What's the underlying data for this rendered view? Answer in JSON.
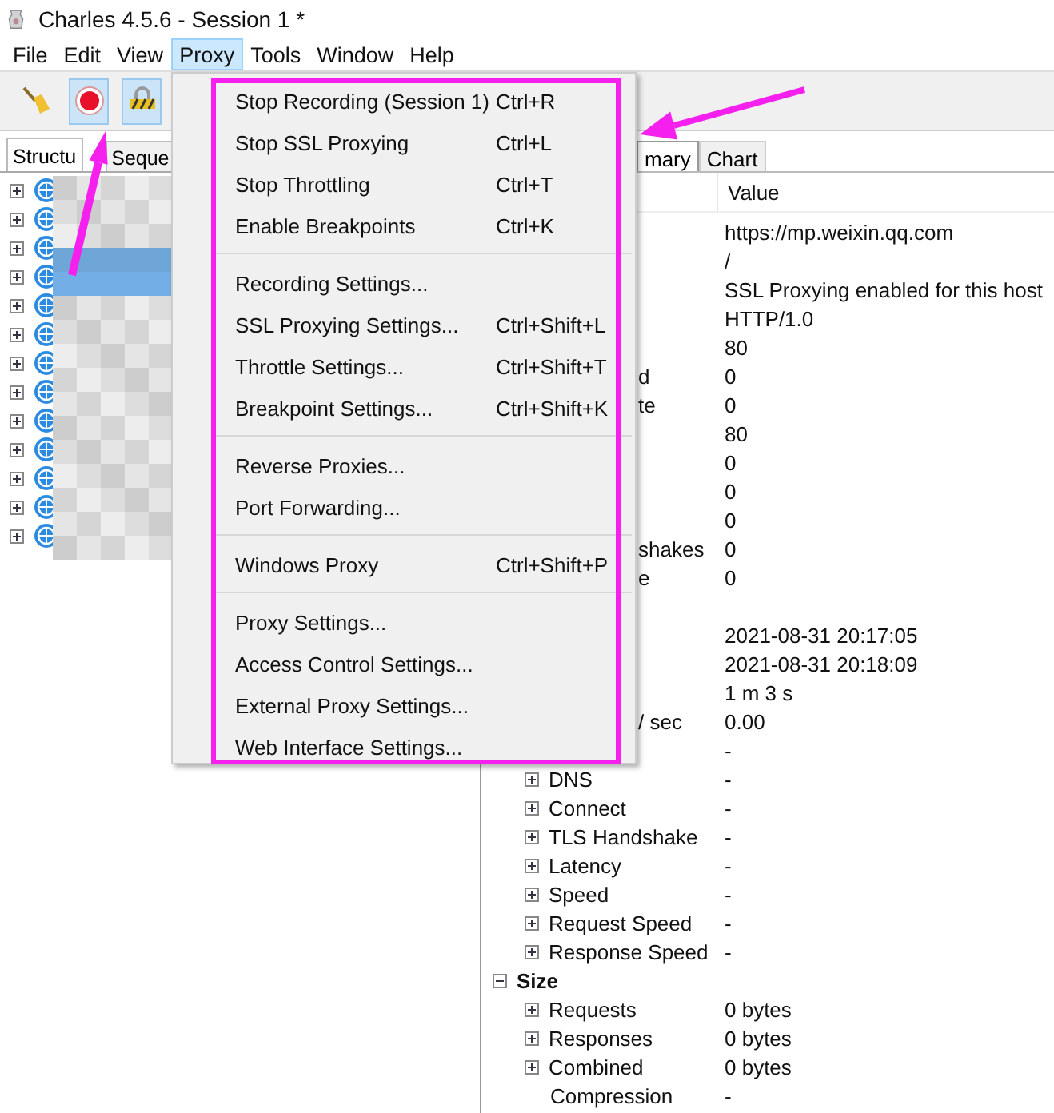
{
  "window": {
    "title": "Charles 4.5.6 - Session 1 *"
  },
  "menu_bar": [
    {
      "label": "File",
      "selected": false
    },
    {
      "label": "Edit",
      "selected": false
    },
    {
      "label": "View",
      "selected": false
    },
    {
      "label": "Proxy",
      "selected": true
    },
    {
      "label": "Tools",
      "selected": false
    },
    {
      "label": "Window",
      "selected": false
    },
    {
      "label": "Help",
      "selected": false
    }
  ],
  "toolbar": [
    {
      "kind": "broom",
      "selected": false
    },
    {
      "kind": "record",
      "selected": true
    },
    {
      "kind": "lock",
      "selected": true
    }
  ],
  "left_panel": {
    "tabs": [
      {
        "label": "Structu",
        "selected": true
      },
      {
        "label": "Seque",
        "selected": false
      }
    ],
    "nodes": [
      {
        "expanded": false
      },
      {
        "expanded": false
      },
      {
        "expanded": false
      },
      {
        "expanded": false
      },
      {
        "expanded": false
      },
      {
        "expanded": false
      },
      {
        "expanded": false
      },
      {
        "expanded": false
      },
      {
        "expanded": false
      },
      {
        "expanded": false
      },
      {
        "expanded": false
      },
      {
        "expanded": false
      },
      {
        "expanded": false
      }
    ]
  },
  "right_panel": {
    "tabs": [
      {
        "label": "mary",
        "selected": true
      },
      {
        "label": "Chart",
        "selected": false
      }
    ],
    "columns": [
      "Value"
    ],
    "rows": [
      {
        "kind": "clipped",
        "value": "https://mp.weixin.qq.com"
      },
      {
        "kind": "clipped",
        "value": "/"
      },
      {
        "kind": "clipped",
        "value": "SSL Proxying enabled for this host"
      },
      {
        "kind": "clipped",
        "value": "HTTP/1.0"
      },
      {
        "kind": "clipped",
        "value": "80"
      },
      {
        "kind": "clipped",
        "name": "d",
        "value": "0"
      },
      {
        "kind": "clipped",
        "name": "te",
        "value": "0"
      },
      {
        "kind": "clipped",
        "value": "80"
      },
      {
        "kind": "clipped",
        "value": "0"
      },
      {
        "kind": "clipped",
        "value": "0"
      },
      {
        "kind": "clipped",
        "value": "0"
      },
      {
        "kind": "clipped",
        "name": "shakes",
        "value": "0"
      },
      {
        "kind": "clipped",
        "name": "e",
        "value": "0"
      },
      {
        "kind": "blank"
      },
      {
        "kind": "clipped",
        "value": "2021-08-31 20:17:05"
      },
      {
        "kind": "clipped",
        "value": "2021-08-31 20:18:09"
      },
      {
        "kind": "clipped",
        "value": "1 m 3 s"
      },
      {
        "kind": "clipped",
        "name": "/ sec",
        "value": "0.00"
      },
      {
        "kind": "clipped",
        "value": "-"
      },
      {
        "kind": "item",
        "name": "DNS",
        "value": "-"
      },
      {
        "kind": "item",
        "name": "Connect",
        "value": "-"
      },
      {
        "kind": "item",
        "name": "TLS Handshake",
        "value": "-"
      },
      {
        "kind": "item",
        "name": "Latency",
        "value": "-"
      },
      {
        "kind": "item",
        "name": "Speed",
        "value": "-"
      },
      {
        "kind": "item",
        "name": "Request Speed",
        "value": "-"
      },
      {
        "kind": "item",
        "name": "Response Speed",
        "value": "-"
      },
      {
        "kind": "group",
        "name": "Size",
        "expanded": true
      },
      {
        "kind": "item",
        "name": "Requests",
        "value": "0 bytes"
      },
      {
        "kind": "item",
        "name": "Responses",
        "value": "0 bytes"
      },
      {
        "kind": "item",
        "name": "Combined",
        "value": "0 bytes"
      },
      {
        "kind": "plain",
        "name": "Compression",
        "value": "-"
      }
    ]
  },
  "proxy_menu": {
    "sections": [
      {
        "items": [
          {
            "label": "Stop Recording (Session 1)",
            "shortcut": "Ctrl+R"
          },
          {
            "label": "Stop SSL Proxying",
            "shortcut": "Ctrl+L"
          },
          {
            "label": "Stop Throttling",
            "shortcut": "Ctrl+T"
          },
          {
            "label": "Enable Breakpoints",
            "shortcut": "Ctrl+K"
          }
        ]
      },
      {
        "items": [
          {
            "label": "Recording Settings..."
          },
          {
            "label": "SSL Proxying Settings...",
            "shortcut": "Ctrl+Shift+L"
          },
          {
            "label": "Throttle Settings...",
            "shortcut": "Ctrl+Shift+T"
          },
          {
            "label": "Breakpoint Settings...",
            "shortcut": "Ctrl+Shift+K"
          }
        ]
      },
      {
        "items": [
          {
            "label": "Reverse Proxies..."
          },
          {
            "label": "Port Forwarding..."
          }
        ]
      },
      {
        "items": [
          {
            "label": "Windows Proxy",
            "shortcut": "Ctrl+Shift+P"
          }
        ]
      },
      {
        "items": [
          {
            "label": "Proxy Settings..."
          },
          {
            "label": "Access Control Settings..."
          },
          {
            "label": "External Proxy Settings..."
          },
          {
            "label": "Web Interface Settings..."
          }
        ]
      }
    ]
  },
  "annotations": [
    {
      "kind": "frame"
    },
    {
      "kind": "arrow_up"
    },
    {
      "kind": "arrow_left"
    }
  ]
}
